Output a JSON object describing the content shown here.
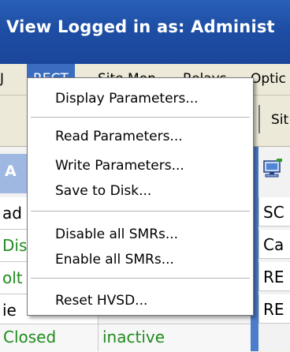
{
  "titlebar": {
    "text": "View   Logged in as: Administ"
  },
  "menubar": {
    "items": [
      "J",
      "RECT",
      "Site Mon",
      "Relays",
      "Optic"
    ],
    "active_index": 1
  },
  "toolbar": {
    "label": "Sit"
  },
  "left_panel": {
    "header": "A",
    "rows": [
      {
        "text": "ad",
        "color": "#000000"
      },
      {
        "text": "Dis",
        "color": "#1e8b1e"
      },
      {
        "text": "olt",
        "color": "#1e8b1e"
      },
      {
        "text": "ie",
        "color": "#000000"
      }
    ],
    "bottom": {
      "left": "Closed",
      "right": "inactive"
    }
  },
  "right_panel": {
    "icon": "computer-network-icon",
    "rows": [
      "SC",
      "Ca",
      "RE",
      "RE"
    ]
  },
  "dropdown": {
    "groups": [
      [
        "Display Parameters..."
      ],
      [
        "Read Parameters...",
        "Write Parameters...",
        "Save to Disk..."
      ],
      [
        "Disable all SMRs...",
        "Enable all SMRs..."
      ],
      [
        "Reset HVSD..."
      ]
    ]
  }
}
